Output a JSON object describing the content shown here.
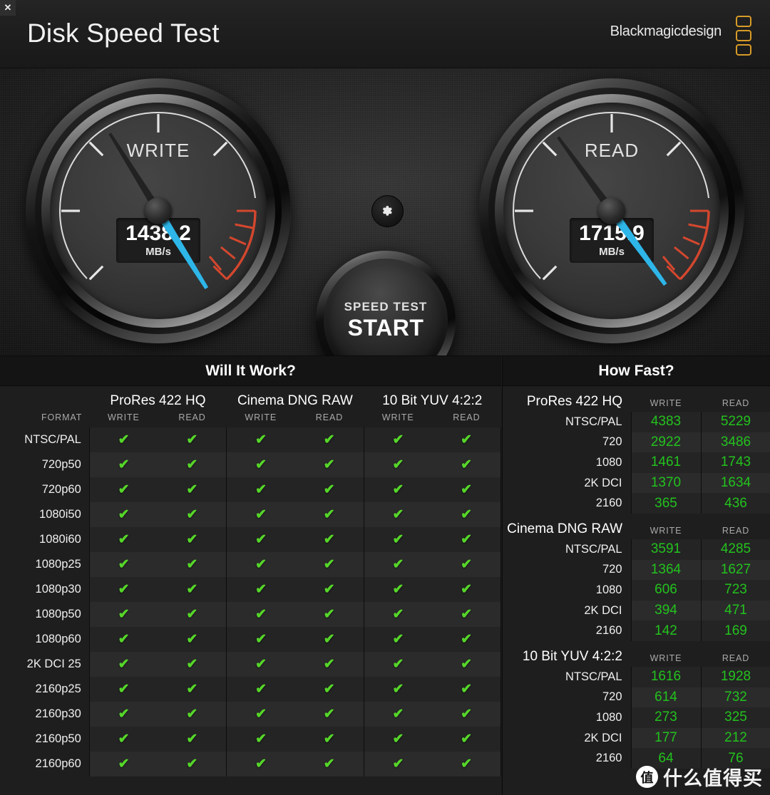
{
  "window": {
    "close_label": "✕"
  },
  "header": {
    "title": "Disk Speed Test",
    "brand": "Blackmagicdesign"
  },
  "gauges": {
    "write": {
      "label": "WRITE",
      "value": "1438.2",
      "unit": "MB/s",
      "needle_deg": -122
    },
    "read": {
      "label": "READ",
      "value": "1715.9",
      "unit": "MB/s",
      "needle_deg": -126
    }
  },
  "controls": {
    "gear_icon": "gear-icon",
    "start_small": "SPEED TEST",
    "start_big": "START"
  },
  "will_it_work": {
    "title": "Will It Work?",
    "format_header": "FORMAT",
    "codec_groups": [
      {
        "name": "ProRes 422 HQ",
        "columns": [
          "WRITE",
          "READ"
        ]
      },
      {
        "name": "Cinema DNG RAW",
        "columns": [
          "WRITE",
          "READ"
        ]
      },
      {
        "name": "10 Bit YUV 4:2:2",
        "columns": [
          "WRITE",
          "READ"
        ]
      }
    ],
    "tick_glyph": "✔",
    "rows": [
      {
        "format": "NTSC/PAL",
        "cells": [
          true,
          true,
          true,
          true,
          true,
          true
        ]
      },
      {
        "format": "720p50",
        "cells": [
          true,
          true,
          true,
          true,
          true,
          true
        ]
      },
      {
        "format": "720p60",
        "cells": [
          true,
          true,
          true,
          true,
          true,
          true
        ]
      },
      {
        "format": "1080i50",
        "cells": [
          true,
          true,
          true,
          true,
          true,
          true
        ]
      },
      {
        "format": "1080i60",
        "cells": [
          true,
          true,
          true,
          true,
          true,
          true
        ]
      },
      {
        "format": "1080p25",
        "cells": [
          true,
          true,
          true,
          true,
          true,
          true
        ]
      },
      {
        "format": "1080p30",
        "cells": [
          true,
          true,
          true,
          true,
          true,
          true
        ]
      },
      {
        "format": "1080p50",
        "cells": [
          true,
          true,
          true,
          true,
          true,
          true
        ]
      },
      {
        "format": "1080p60",
        "cells": [
          true,
          true,
          true,
          true,
          true,
          true
        ]
      },
      {
        "format": "2K DCI 25",
        "cells": [
          true,
          true,
          true,
          true,
          true,
          true
        ]
      },
      {
        "format": "2160p25",
        "cells": [
          true,
          true,
          true,
          true,
          true,
          true
        ]
      },
      {
        "format": "2160p30",
        "cells": [
          true,
          true,
          true,
          true,
          true,
          true
        ]
      },
      {
        "format": "2160p50",
        "cells": [
          true,
          true,
          true,
          true,
          true,
          true
        ]
      },
      {
        "format": "2160p60",
        "cells": [
          true,
          true,
          true,
          true,
          true,
          true
        ]
      }
    ]
  },
  "how_fast": {
    "title": "How Fast?",
    "col_write": "WRITE",
    "col_read": "READ",
    "groups": [
      {
        "name": "ProRes 422 HQ",
        "rows": [
          {
            "label": "NTSC/PAL",
            "write": "4383",
            "read": "5229"
          },
          {
            "label": "720",
            "write": "2922",
            "read": "3486"
          },
          {
            "label": "1080",
            "write": "1461",
            "read": "1743"
          },
          {
            "label": "2K DCI",
            "write": "1370",
            "read": "1634"
          },
          {
            "label": "2160",
            "write": "365",
            "read": "436"
          }
        ]
      },
      {
        "name": "Cinema DNG RAW",
        "rows": [
          {
            "label": "NTSC/PAL",
            "write": "3591",
            "read": "4285"
          },
          {
            "label": "720",
            "write": "1364",
            "read": "1627"
          },
          {
            "label": "1080",
            "write": "606",
            "read": "723"
          },
          {
            "label": "2K DCI",
            "write": "394",
            "read": "471"
          },
          {
            "label": "2160",
            "write": "142",
            "read": "169"
          }
        ]
      },
      {
        "name": "10 Bit YUV 4:2:2",
        "rows": [
          {
            "label": "NTSC/PAL",
            "write": "1616",
            "read": "1928"
          },
          {
            "label": "720",
            "write": "614",
            "read": "732"
          },
          {
            "label": "1080",
            "write": "273",
            "read": "325"
          },
          {
            "label": "2K DCI",
            "write": "177",
            "read": "212"
          },
          {
            "label": "2160",
            "write": "64",
            "read": "76"
          }
        ]
      }
    ]
  },
  "watermark": {
    "badge": "值",
    "text": "什么值得买"
  },
  "colors": {
    "accent_green": "#23c21e",
    "tick_green": "#56d62a",
    "needle_blue": "#2eb6e8",
    "redzone": "#d4472e",
    "brand_gold": "#d79b28"
  }
}
